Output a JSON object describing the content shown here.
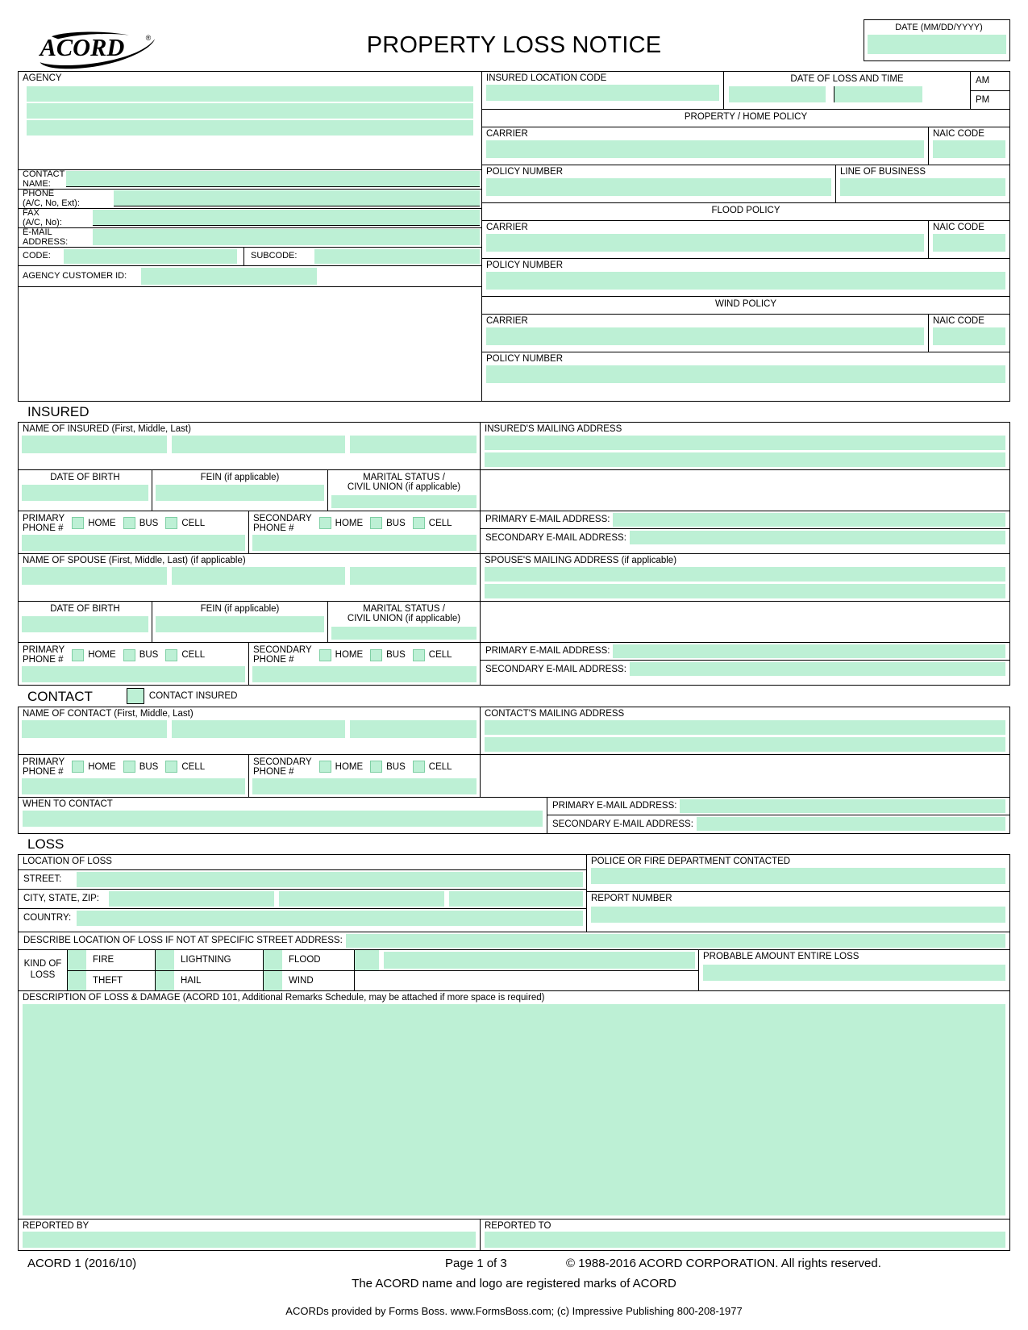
{
  "header": {
    "logo_alt": "ACORD",
    "title": "PROPERTY LOSS NOTICE",
    "date_label": "DATE (MM/DD/YYYY)",
    "date_value": ""
  },
  "agency": {
    "label": "AGENCY",
    "lines": [
      "",
      "",
      ""
    ],
    "contact_name_label": "CONTACT\nNAME:",
    "contact_name_l1": "CONTACT",
    "contact_name_l2": "NAME:",
    "phone_l1": "PHONE",
    "phone_l2": "(A/C, No, Ext):",
    "fax_l1": "FAX",
    "fax_l2": "(A/C, No):",
    "email_l1": "E-MAIL",
    "email_l2": "ADDRESS:",
    "code_label": "CODE:",
    "subcode_label": "SUBCODE:",
    "customer_id_label": "AGENCY CUSTOMER ID:"
  },
  "policy": {
    "insured_location_code_label": "INSURED LOCATION CODE",
    "date_of_loss_label": "DATE OF LOSS AND TIME",
    "am_label": "AM",
    "pm_label": "PM",
    "property_home_policy": "PROPERTY / HOME POLICY",
    "flood_policy": "FLOOD POLICY",
    "wind_policy": "WIND POLICY",
    "carrier_label": "CARRIER",
    "naic_label": "NAIC CODE",
    "policy_number_label": "POLICY NUMBER",
    "line_of_business_label": "LINE OF BUSINESS"
  },
  "insured": {
    "section_title": "INSURED",
    "name_label": "NAME OF INSURED (First, Middle, Last)",
    "dob_label": "DATE OF BIRTH",
    "fein_label": "FEIN (if applicable)",
    "marital_l1": "MARITAL STATUS /",
    "marital_l2": "CIVIL UNION (if applicable)",
    "primary_phone_l1": "PRIMARY",
    "primary_phone_l2": "PHONE #",
    "secondary_phone_l1": "SECONDARY",
    "secondary_phone_l2": "PHONE #",
    "home_label": "HOME",
    "bus_label": "BUS",
    "cell_label": "CELL",
    "mailing_address_label": "INSURED'S MAILING ADDRESS",
    "primary_email_label": "PRIMARY E-MAIL ADDRESS:",
    "secondary_email_label": "SECONDARY E-MAIL ADDRESS:",
    "spouse_name_label": "NAME OF SPOUSE (First, Middle, Last) (if applicable)",
    "spouse_mailing_label": "SPOUSE'S MAILING ADDRESS (if applicable)"
  },
  "contact": {
    "section_title": "CONTACT",
    "contact_insured_label": "CONTACT INSURED",
    "name_label": "NAME OF CONTACT (First, Middle, Last)",
    "mailing_address_label": "CONTACT'S MAILING ADDRESS",
    "when_to_contact_label": "WHEN TO CONTACT",
    "primary_phone_l1": "PRIMARY",
    "primary_phone_l2": "PHONE #",
    "secondary_phone_l1": "SECONDARY",
    "secondary_phone_l2": "PHONE #",
    "home_label": "HOME",
    "bus_label": "BUS",
    "cell_label": "CELL",
    "primary_email_label": "PRIMARY E-MAIL ADDRESS:",
    "secondary_email_label": "SECONDARY E-MAIL ADDRESS:"
  },
  "loss": {
    "section_title": "LOSS",
    "location_of_loss_label": "LOCATION OF LOSS",
    "street_label": "STREET:",
    "city_state_zip_label": "CITY, STATE, ZIP:",
    "country_label": "COUNTRY:",
    "describe_location_label": "DESCRIBE LOCATION OF LOSS IF NOT AT SPECIFIC STREET ADDRESS:",
    "police_fire_label": "POLICE OR FIRE DEPARTMENT CONTACTED",
    "report_number_label": "REPORT NUMBER",
    "kind_of_loss_l1": "KIND OF",
    "kind_of_loss_l2": "LOSS",
    "kinds": [
      "FIRE",
      "LIGHTNING",
      "FLOOD",
      "THEFT",
      "HAIL",
      "WIND"
    ],
    "probable_amount_label": "PROBABLE AMOUNT ENTIRE LOSS",
    "description_label": "DESCRIPTION OF LOSS & DAMAGE (ACORD 101, Additional Remarks Schedule, may be attached if more space is required)",
    "reported_by_label": "REPORTED BY",
    "reported_to_label": "REPORTED TO"
  },
  "footer": {
    "form_id": "ACORD 1 (2016/10)",
    "page": "Page 1 of 3",
    "copyright": "© 1988-2016 ACORD CORPORATION.  All rights reserved.",
    "trademark": "The ACORD name and logo are registered marks of ACORD",
    "provider": "ACORDs provided by Forms Boss. www.FormsBoss.com; (c) Impressive Publishing 800-208-1977"
  },
  "colors": {
    "field_fill": "#bdf0d5",
    "border": "#000000"
  }
}
